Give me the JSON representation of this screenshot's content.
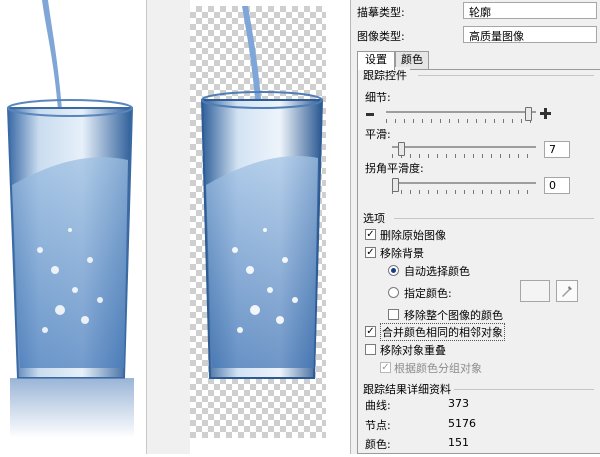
{
  "panel": {
    "trace_type_label": "描摹类型:",
    "trace_type_value": "轮廓",
    "image_type_label": "图像类型:",
    "image_type_value": "高质量图像",
    "tabs": [
      "设置",
      "颜色"
    ],
    "tracing_control": {
      "title": "跟踪控件",
      "detail_label": "细节:",
      "detail_level": 0.97,
      "smooth_label": "平滑:",
      "smooth_value": "7",
      "corner_label": "拐角平滑度:",
      "corner_value": "0"
    },
    "options": {
      "title": "选项",
      "delete_original": "删除原始图像",
      "remove_background": "移除背景",
      "auto_select_color": "自动选择颜色",
      "specify_color": "指定颜色:",
      "remove_whole_image_color": "移除整个图像的颜色",
      "merge_adjacent": "合并颜色相同的相邻对象",
      "remove_overlap": "移除对象重叠",
      "group_by_color": "根据颜色分组对象"
    },
    "results": {
      "title": "跟踪结果详细资料",
      "curves_label": "曲线:",
      "curves_value": "373",
      "nodes_label": "节点:",
      "nodes_value": "5176",
      "colors_label": "颜色:",
      "colors_value": "151"
    }
  },
  "colors": {
    "panel_bg": "#f0f0f0",
    "glass_blue": "#2f5f99",
    "glass_light": "#cfe0f2"
  }
}
